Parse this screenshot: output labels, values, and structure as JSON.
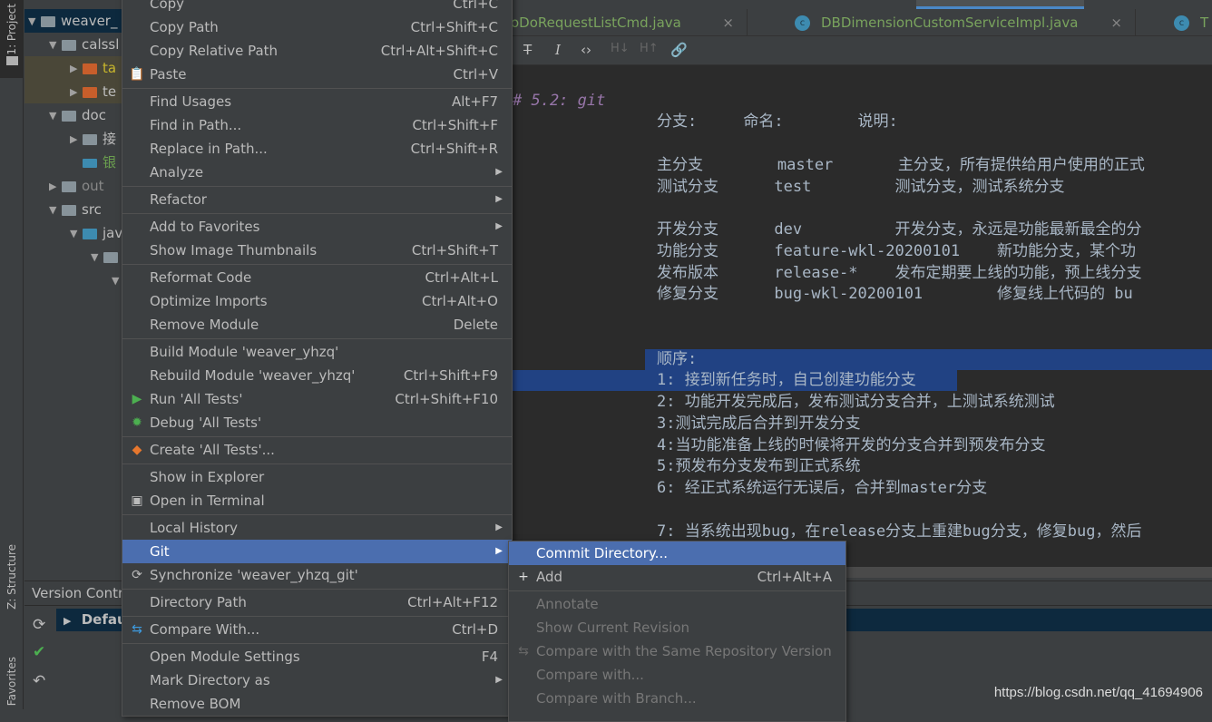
{
  "left_toolbar": {
    "project": "1: Project",
    "structure": "Z: Structure",
    "favorites": "Favorites"
  },
  "tree": [
    {
      "label": "weaver_",
      "depth": 0,
      "expanded": true,
      "selected": true
    },
    {
      "label": "calssl",
      "depth": 1,
      "expanded": true
    },
    {
      "label": "ta",
      "depth": 2,
      "expanded": false,
      "color": "#c8b62c",
      "folder": "#c75e2b"
    },
    {
      "label": "te",
      "depth": 2,
      "expanded": false,
      "folder": "#c75e2b"
    },
    {
      "label": "doc",
      "depth": 1,
      "expanded": true
    },
    {
      "label": "接",
      "depth": 2,
      "expanded": false
    },
    {
      "label": "银",
      "depth": 2,
      "file": "MD",
      "color": "#6a9e4e"
    },
    {
      "label": "out",
      "depth": 1,
      "expanded": false,
      "color": "#888888"
    },
    {
      "label": "src",
      "depth": 1,
      "expanded": true
    },
    {
      "label": "jav",
      "depth": 2,
      "expanded": true,
      "folder": "#3d8bb0"
    },
    {
      "label": "",
      "depth": 3,
      "expanded": true
    },
    {
      "label": "",
      "depth": 4,
      "expanded": true
    }
  ],
  "tabs": [
    {
      "label": "oDoRequestListCmd.java",
      "icon": "class-icon"
    },
    {
      "label": "DBDimensionCustomServiceImpl.java",
      "icon": "class-icon"
    },
    {
      "label": "T",
      "icon": "class-icon"
    }
  ],
  "toolbar_icons": [
    "strikethrough-icon",
    "italic-icon",
    "code-icon",
    "header-down-icon",
    "header-up-icon",
    "link-icon"
  ],
  "editor": {
    "heading": "# 5.2: git",
    "lines": [
      "分支:     命名:        说明:",
      "",
      "主分支        master       主分支，所有提供给用户使用的正式",
      "测试分支      test         测试分支，测试系统分支",
      "",
      "开发分支      dev          开发分支，永远是功能最新最全的分",
      "功能分支      feature-wkl-20200101    新功能分支，某个功",
      "发布版本      release-*    发布定期要上线的功能，预上线分支",
      "修复分支      bug-wkl-20200101        修复线上代码的 bu",
      "",
      "",
      "",
      "顺序:",
      "1: 接到新任务时，自己创建功能分支",
      "2: 功能开发完成后，发布测试分支合并，上测试系统测试",
      "3:测试完成后合并到开发分支",
      "4:当功能准备上线的时候将开发的分支合并到预发布分支",
      "5:预发布分支发布到正式系统",
      "6: 经正式系统运行无误后，合并到master分支",
      "",
      "7: 当系统出现bug，在release分支上重建bug分支，修复bug，然后"
    ]
  },
  "version_control": {
    "title": "Version Control",
    "row": "Defau"
  },
  "menu": [
    {
      "label": "Copy",
      "shortcut": "Ctrl+C"
    },
    {
      "label": "Copy Path",
      "shortcut": "Ctrl+Shift+C"
    },
    {
      "label": "Copy Relative Path",
      "shortcut": "Ctrl+Alt+Shift+C"
    },
    {
      "label": "Paste",
      "shortcut": "Ctrl+V",
      "icon": "paste-icon"
    },
    {
      "sep": true
    },
    {
      "label": "Find Usages",
      "shortcut": "Alt+F7"
    },
    {
      "label": "Find in Path...",
      "shortcut": "Ctrl+Shift+F"
    },
    {
      "label": "Replace in Path...",
      "shortcut": "Ctrl+Shift+R"
    },
    {
      "label": "Analyze",
      "submenu": true
    },
    {
      "sep": true
    },
    {
      "label": "Refactor",
      "submenu": true
    },
    {
      "sep": true
    },
    {
      "label": "Add to Favorites",
      "submenu": true
    },
    {
      "label": "Show Image Thumbnails",
      "shortcut": "Ctrl+Shift+T"
    },
    {
      "sep": true
    },
    {
      "label": "Reformat Code",
      "shortcut": "Ctrl+Alt+L"
    },
    {
      "label": "Optimize Imports",
      "shortcut": "Ctrl+Alt+O"
    },
    {
      "label": "Remove Module",
      "shortcut": "Delete"
    },
    {
      "sep": true
    },
    {
      "label": "Build Module 'weaver_yhzq'"
    },
    {
      "label": "Rebuild Module 'weaver_yhzq'",
      "shortcut": "Ctrl+Shift+F9"
    },
    {
      "label": "Run 'All Tests'",
      "shortcut": "Ctrl+Shift+F10",
      "icon": "run-icon"
    },
    {
      "label": "Debug 'All Tests'",
      "icon": "debug-icon"
    },
    {
      "sep": true
    },
    {
      "label": "Create 'All Tests'...",
      "icon": "create-test-icon"
    },
    {
      "sep": true
    },
    {
      "label": "Show in Explorer"
    },
    {
      "label": "Open in Terminal",
      "icon": "terminal-icon"
    },
    {
      "sep": true
    },
    {
      "label": "Local History",
      "submenu": true
    },
    {
      "label": "Git",
      "submenu": true,
      "highlighted": true
    },
    {
      "label": "Synchronize 'weaver_yhzq_git'",
      "icon": "sync-icon"
    },
    {
      "sep": true
    },
    {
      "label": "Directory Path",
      "shortcut": "Ctrl+Alt+F12"
    },
    {
      "sep": true
    },
    {
      "label": "Compare With...",
      "shortcut": "Ctrl+D",
      "icon": "compare-icon"
    },
    {
      "sep": true
    },
    {
      "label": "Open Module Settings",
      "shortcut": "F4"
    },
    {
      "label": "Mark Directory as",
      "submenu": true
    },
    {
      "label": "Remove BOM"
    }
  ],
  "git_submenu": [
    {
      "label": "Commit Directory...",
      "highlighted": true
    },
    {
      "label": "Add",
      "shortcut": "Ctrl+Alt+A",
      "icon": "plus-icon"
    },
    {
      "sep": true
    },
    {
      "label": "Annotate",
      "disabled": true
    },
    {
      "label": "Show Current Revision",
      "disabled": true
    },
    {
      "label": "Compare with the Same Repository Version",
      "disabled": true,
      "icon": "compare-icon"
    },
    {
      "label": "Compare with...",
      "disabled": true
    },
    {
      "label": "Compare with Branch...",
      "disabled": true
    }
  ],
  "watermark": "https://blog.csdn.net/qq_41694906",
  "colors": {
    "highlight": "#4b6eaf",
    "selection": "#214283",
    "editor_bg": "#2b2b2b",
    "panel_bg": "#3c3f41",
    "heading": "#9876aa"
  }
}
